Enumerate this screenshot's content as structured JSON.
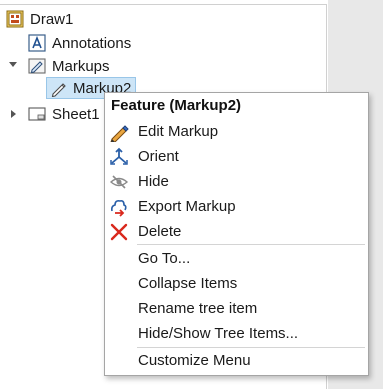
{
  "tree": {
    "nodes": {
      "root": {
        "label": "Draw1",
        "icon": "drawing-icon"
      },
      "annotations": {
        "label": "Annotations",
        "icon": "annotations-icon"
      },
      "markups": {
        "label": "Markups",
        "icon": "markups-folder-icon",
        "expanded": true
      },
      "markup2": {
        "label": "Markup2",
        "icon": "markup-pen-icon",
        "selected": true
      },
      "sheet1": {
        "label": "Sheet1",
        "icon": "sheet-icon",
        "expanded": false
      }
    }
  },
  "context_menu": {
    "title": "Feature (Markup2)",
    "items": [
      {
        "label": "Edit Markup",
        "icon": "edit-pen-icon"
      },
      {
        "label": "Orient",
        "icon": "orient-icon"
      },
      {
        "label": "Hide",
        "icon": "hide-eye-icon"
      },
      {
        "label": "Export Markup",
        "icon": "export-icon"
      },
      {
        "label": "Delete",
        "icon": "delete-x-icon"
      },
      {
        "label": "Go To..."
      },
      {
        "label": "Collapse Items"
      },
      {
        "label": "Rename tree item"
      },
      {
        "label": "Hide/Show Tree Items..."
      },
      {
        "label": "Customize Menu"
      }
    ]
  },
  "colors": {
    "selection_bg": "#cde5f7",
    "delete_red": "#d9281c",
    "icon_blue": "#2a5fa8"
  }
}
